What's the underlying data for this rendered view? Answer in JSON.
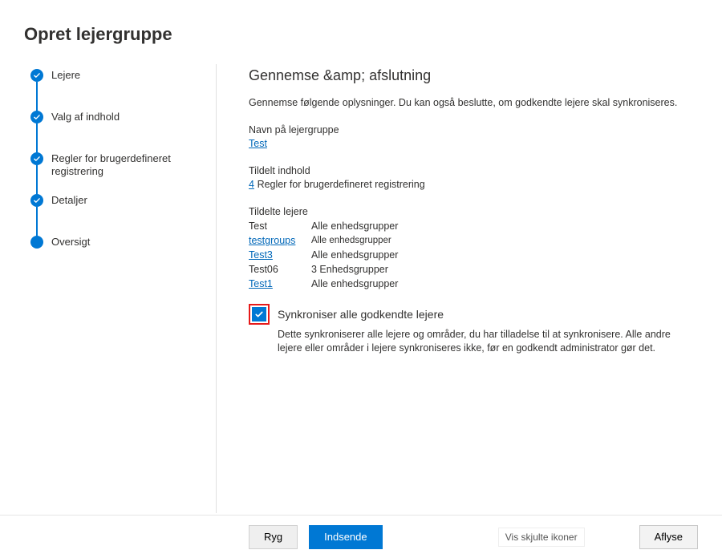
{
  "title": "Opret lejergruppe",
  "wizard": {
    "steps": [
      {
        "label": "Lejere",
        "state": "done"
      },
      {
        "label": "Valg af indhold",
        "state": "done"
      },
      {
        "label": "Regler for brugerdefineret registrering",
        "state": "done"
      },
      {
        "label": "Detaljer",
        "state": "done"
      },
      {
        "label": "Oversigt",
        "state": "current"
      }
    ]
  },
  "review": {
    "heading": "Gennemse &amp; afslutning",
    "description": "Gennemse følgende oplysninger. Du kan også beslutte, om godkendte lejere skal synkroniseres.",
    "group_name_label": "Navn på lejergruppe",
    "group_name_value": "Test",
    "assigned_content_label": "Tildelt indhold",
    "assigned_content_count": "4",
    "assigned_content_text": "Regler for brugerdefineret registrering",
    "assigned_tenants_label": "Tildelte lejere",
    "tenants": [
      {
        "name": "Test",
        "scope": "Alle enhedsgrupper",
        "link": false
      },
      {
        "name": "testgroups",
        "scope": "Alle enhedsgrupper",
        "link": true
      },
      {
        "name": "Test3",
        "scope": "Alle enhedsgrupper",
        "link": true
      },
      {
        "name": "Test06",
        "scope": "3 Enhedsgrupper",
        "link": false
      },
      {
        "name": "Test1",
        "scope": "Alle enhedsgrupper",
        "link": true
      }
    ],
    "sync_checkbox": {
      "checked": true,
      "highlighted": true,
      "label": "Synkroniser alle godkendte lejere",
      "description": "Dette synkroniserer alle lejere og områder, du har tilladelse til at synkronisere. Alle andre lejere eller områder i lejere synkroniseres ikke, før en godkendt administrator gør det."
    }
  },
  "footer": {
    "back": "Ryg",
    "submit": "Indsende",
    "hidden_icons": "Vis skjulte ikoner",
    "cancel": "Aflyse"
  }
}
